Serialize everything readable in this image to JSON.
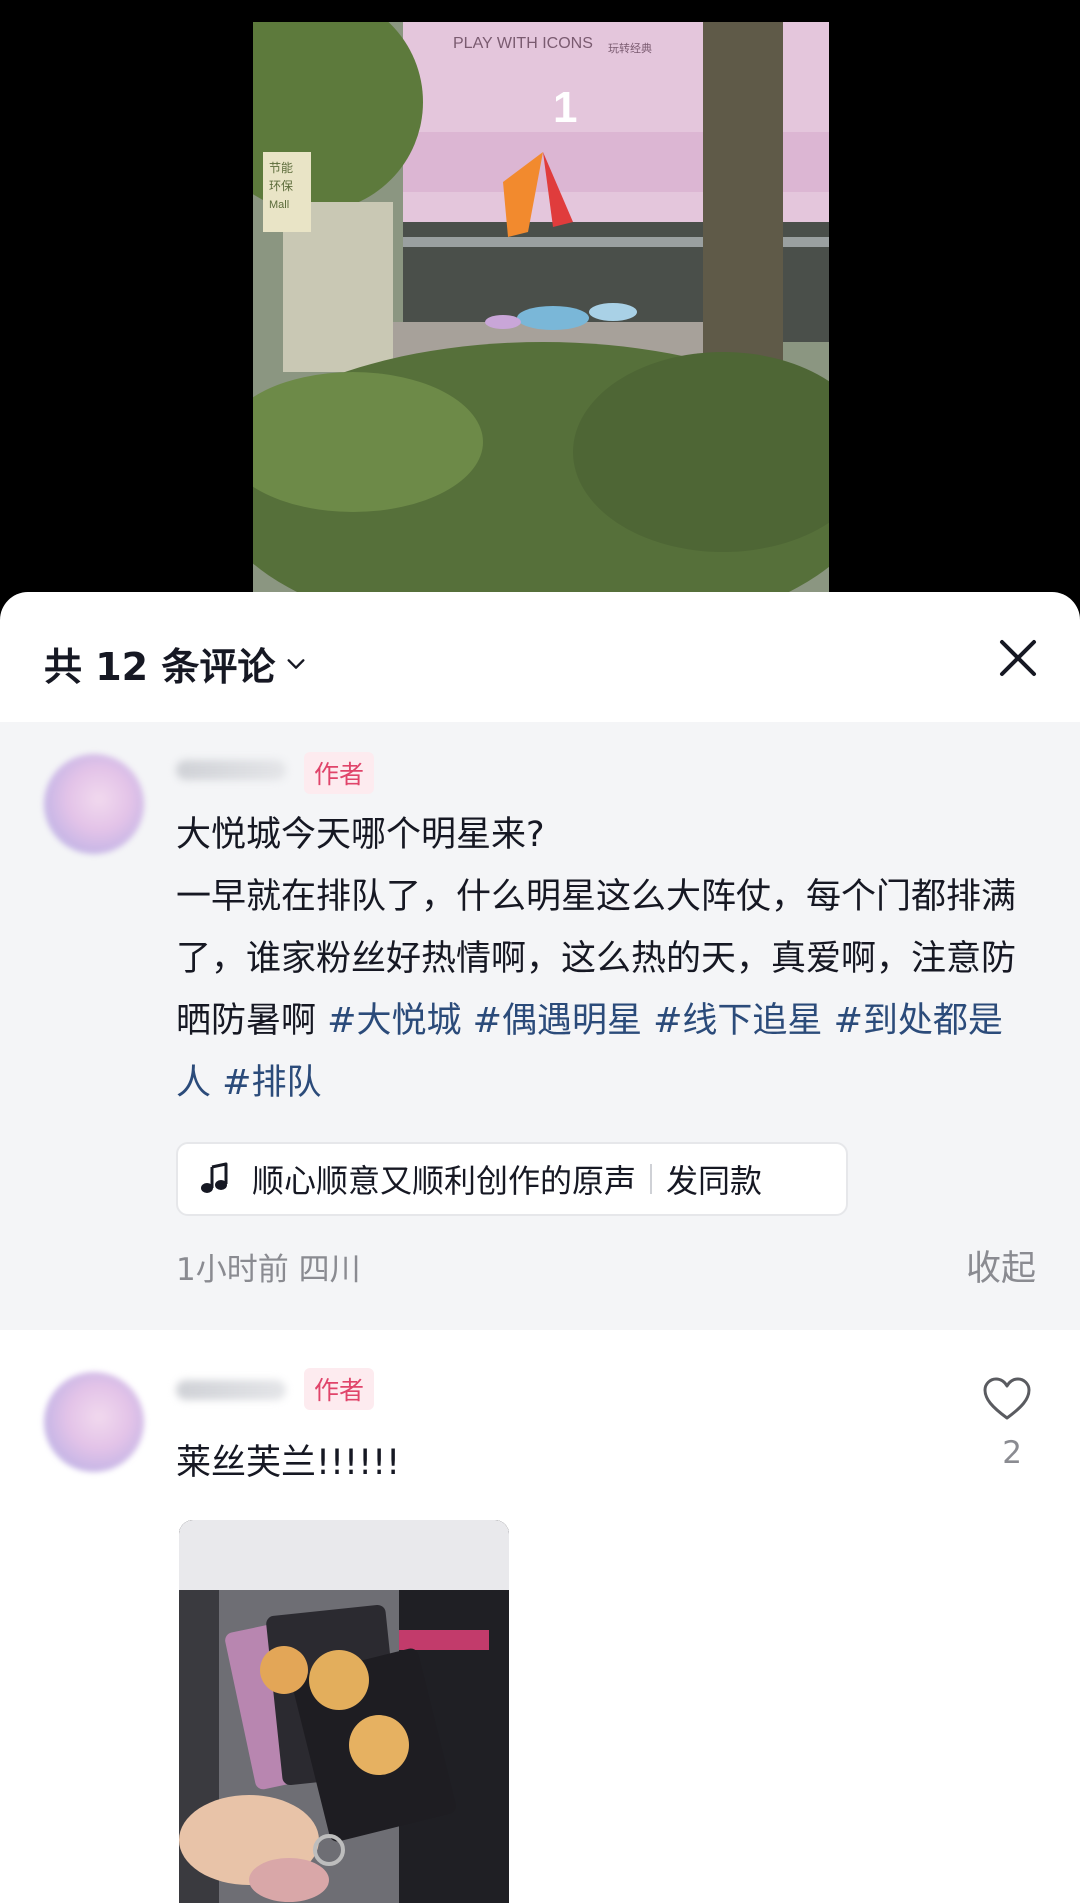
{
  "video": {
    "sign_top": "PLAY WITH ICONS",
    "sign_cn": "玩转经典",
    "floor_number": "1",
    "side_sign_1": "节能",
    "side_sign_2": "环保",
    "side_sign_3": "Mall"
  },
  "sheet": {
    "title": "共 12 条评论",
    "chevron_icon": "chevron-down-icon",
    "close_icon": "close-icon"
  },
  "pinned_comment": {
    "author_tag": "作者",
    "text_line1": "大悦城今天哪个明星来?",
    "text_body": "一早就在排队了，什么明星这么大阵仗，每个门都排满了，谁家粉丝好热情啊，这么热的天，真爱啊，注意防晒防暑啊",
    "hashtags": [
      "#大悦城",
      "#偶遇明星",
      "#线下追星",
      "#到处都是人",
      "#排队"
    ],
    "music_icon": "music-note-icon",
    "music_title": "顺心顺意又顺利创作的原声",
    "music_action": "发同款",
    "time": "1小时前",
    "location": "四川",
    "collapse_label": "收起"
  },
  "comment2": {
    "author_tag": "作者",
    "text": "莱丝芙兰!!!!!!",
    "like_icon": "heart-icon",
    "like_count": "2"
  }
}
